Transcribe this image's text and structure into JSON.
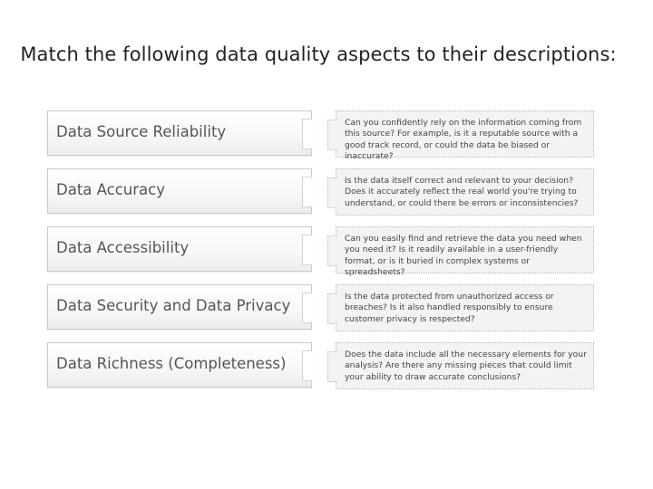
{
  "question": "Match the following data quality aspects to their descriptions:",
  "pairs": [
    {
      "term": "Data Source Reliability",
      "description": "Can you confidently rely on the information coming from this source? For example, is it a reputable source with a good track record, or could the data be biased or inaccurate?"
    },
    {
      "term": "Data Accuracy",
      "description": "Is the data itself correct and relevant to your decision? Does it accurately reflect the real world you're trying to understand, or could there be errors or inconsistencies?"
    },
    {
      "term": "Data Accessibility",
      "description": "Can you easily find and retrieve the data you need when you need it? Is it readily available in a user-friendly format, or is it buried in complex systems or spreadsheets?"
    },
    {
      "term": "Data Security and Data Privacy",
      "description": "Is the data protected from unauthorized access or breaches? Is it also handled responsibly to ensure customer privacy is respected?"
    },
    {
      "term": "Data Richness (Completeness)",
      "description": "Does the data include all the necessary elements for your analysis? Are there any missing pieces that could limit your ability to draw accurate conclusions?"
    }
  ]
}
